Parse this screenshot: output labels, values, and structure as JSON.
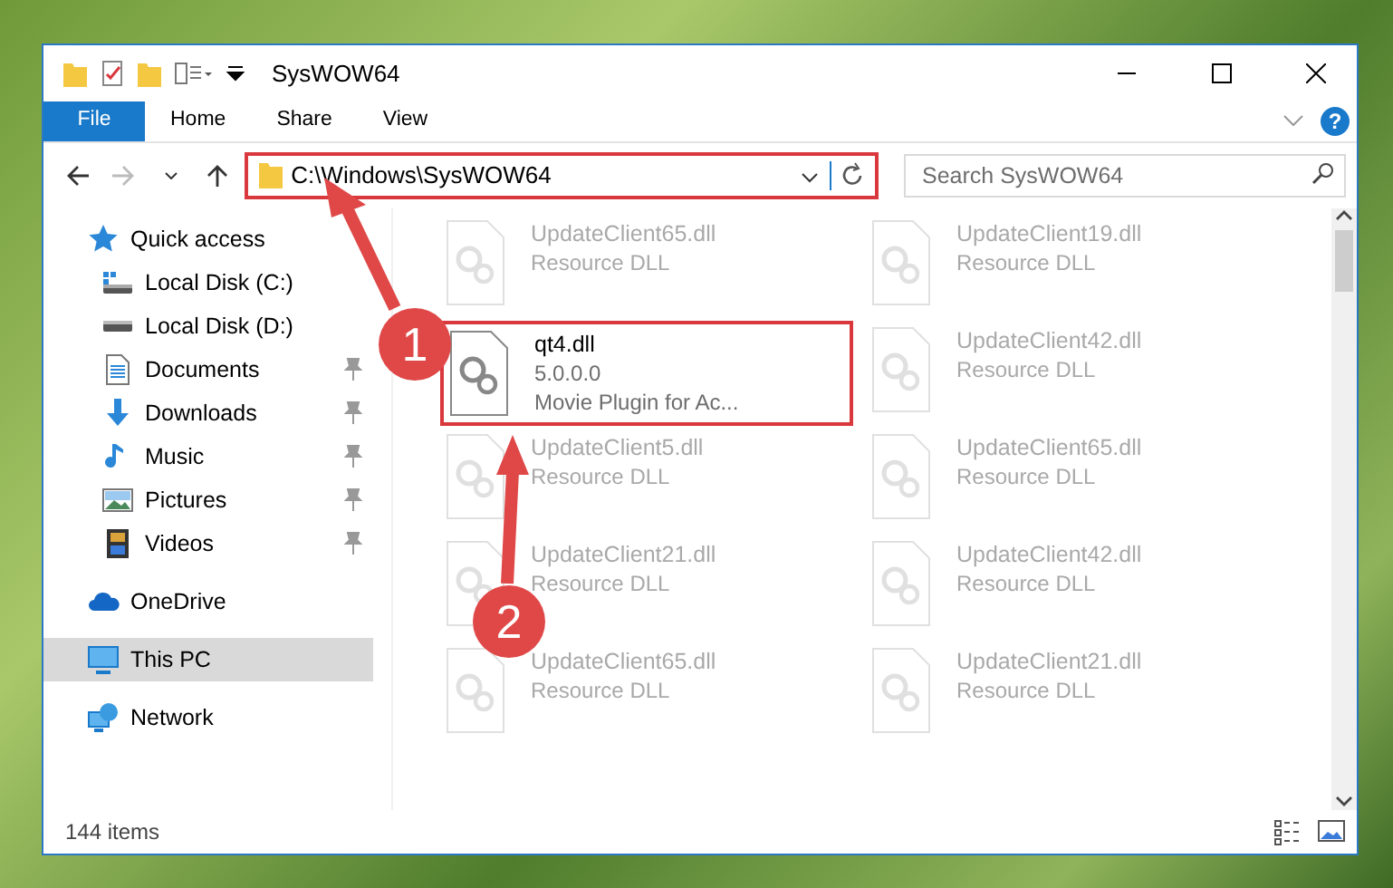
{
  "window": {
    "title": "SysWOW64"
  },
  "ribbon": {
    "tabs": [
      {
        "label": "File",
        "selected": true
      },
      {
        "label": "Home",
        "selected": false
      },
      {
        "label": "Share",
        "selected": false
      },
      {
        "label": "View",
        "selected": false
      }
    ],
    "help": "?"
  },
  "address_bar": {
    "path": "C:\\Windows\\SysWOW64",
    "highlighted": true
  },
  "search": {
    "placeholder": "Search SysWOW64"
  },
  "sidebar": {
    "items": [
      {
        "label": "Quick access",
        "kind": "star",
        "selected": false,
        "children": [
          {
            "label": "Local Disk (C:)",
            "kind": "system-drive",
            "pinned": false,
            "selected": false
          },
          {
            "label": "Local Disk (D:)",
            "kind": "drive",
            "pinned": false,
            "selected": false
          },
          {
            "label": "Documents",
            "kind": "documents",
            "pinned": true,
            "selected": false
          },
          {
            "label": "Downloads",
            "kind": "downloads",
            "pinned": true,
            "selected": false
          },
          {
            "label": "Music",
            "kind": "music",
            "pinned": true,
            "selected": false
          },
          {
            "label": "Pictures",
            "kind": "pictures",
            "pinned": true,
            "selected": false
          },
          {
            "label": "Videos",
            "kind": "videos",
            "pinned": true,
            "selected": false
          }
        ]
      },
      {
        "label": "OneDrive",
        "kind": "cloud",
        "selected": false
      },
      {
        "label": "This PC",
        "kind": "computer",
        "selected": true
      },
      {
        "label": "Network",
        "kind": "network",
        "selected": false
      }
    ]
  },
  "files": [
    {
      "name": "UpdateClient65.dll",
      "details": [
        "Resource DLL"
      ],
      "faded": true,
      "highlighted": false
    },
    {
      "name": "UpdateClient19.dll",
      "details": [
        "Resource DLL"
      ],
      "faded": true,
      "highlighted": false
    },
    {
      "name": "qt4.dll",
      "details": [
        "5.0.0.0",
        "Movie Plugin for Ac..."
      ],
      "faded": false,
      "highlighted": true
    },
    {
      "name": "UpdateClient42.dll",
      "details": [
        "Resource DLL"
      ],
      "faded": true,
      "highlighted": false
    },
    {
      "name": "UpdateClient5.dll",
      "details": [
        "Resource DLL"
      ],
      "faded": true,
      "highlighted": false
    },
    {
      "name": "UpdateClient65.dll",
      "details": [
        "Resource DLL"
      ],
      "faded": true,
      "highlighted": false
    },
    {
      "name": "UpdateClient21.dll",
      "details": [
        "Resource DLL"
      ],
      "faded": true,
      "highlighted": false
    },
    {
      "name": "UpdateClient42.dll",
      "details": [
        "Resource DLL"
      ],
      "faded": true,
      "highlighted": false
    },
    {
      "name": "UpdateClient65.dll",
      "details": [
        "Resource DLL"
      ],
      "faded": true,
      "highlighted": false
    },
    {
      "name": "UpdateClient21.dll",
      "details": [
        "Resource DLL"
      ],
      "faded": true,
      "highlighted": false
    }
  ],
  "status_bar": {
    "count": "144 items"
  },
  "annotations": [
    {
      "label": "1"
    },
    {
      "label": "2"
    }
  ]
}
